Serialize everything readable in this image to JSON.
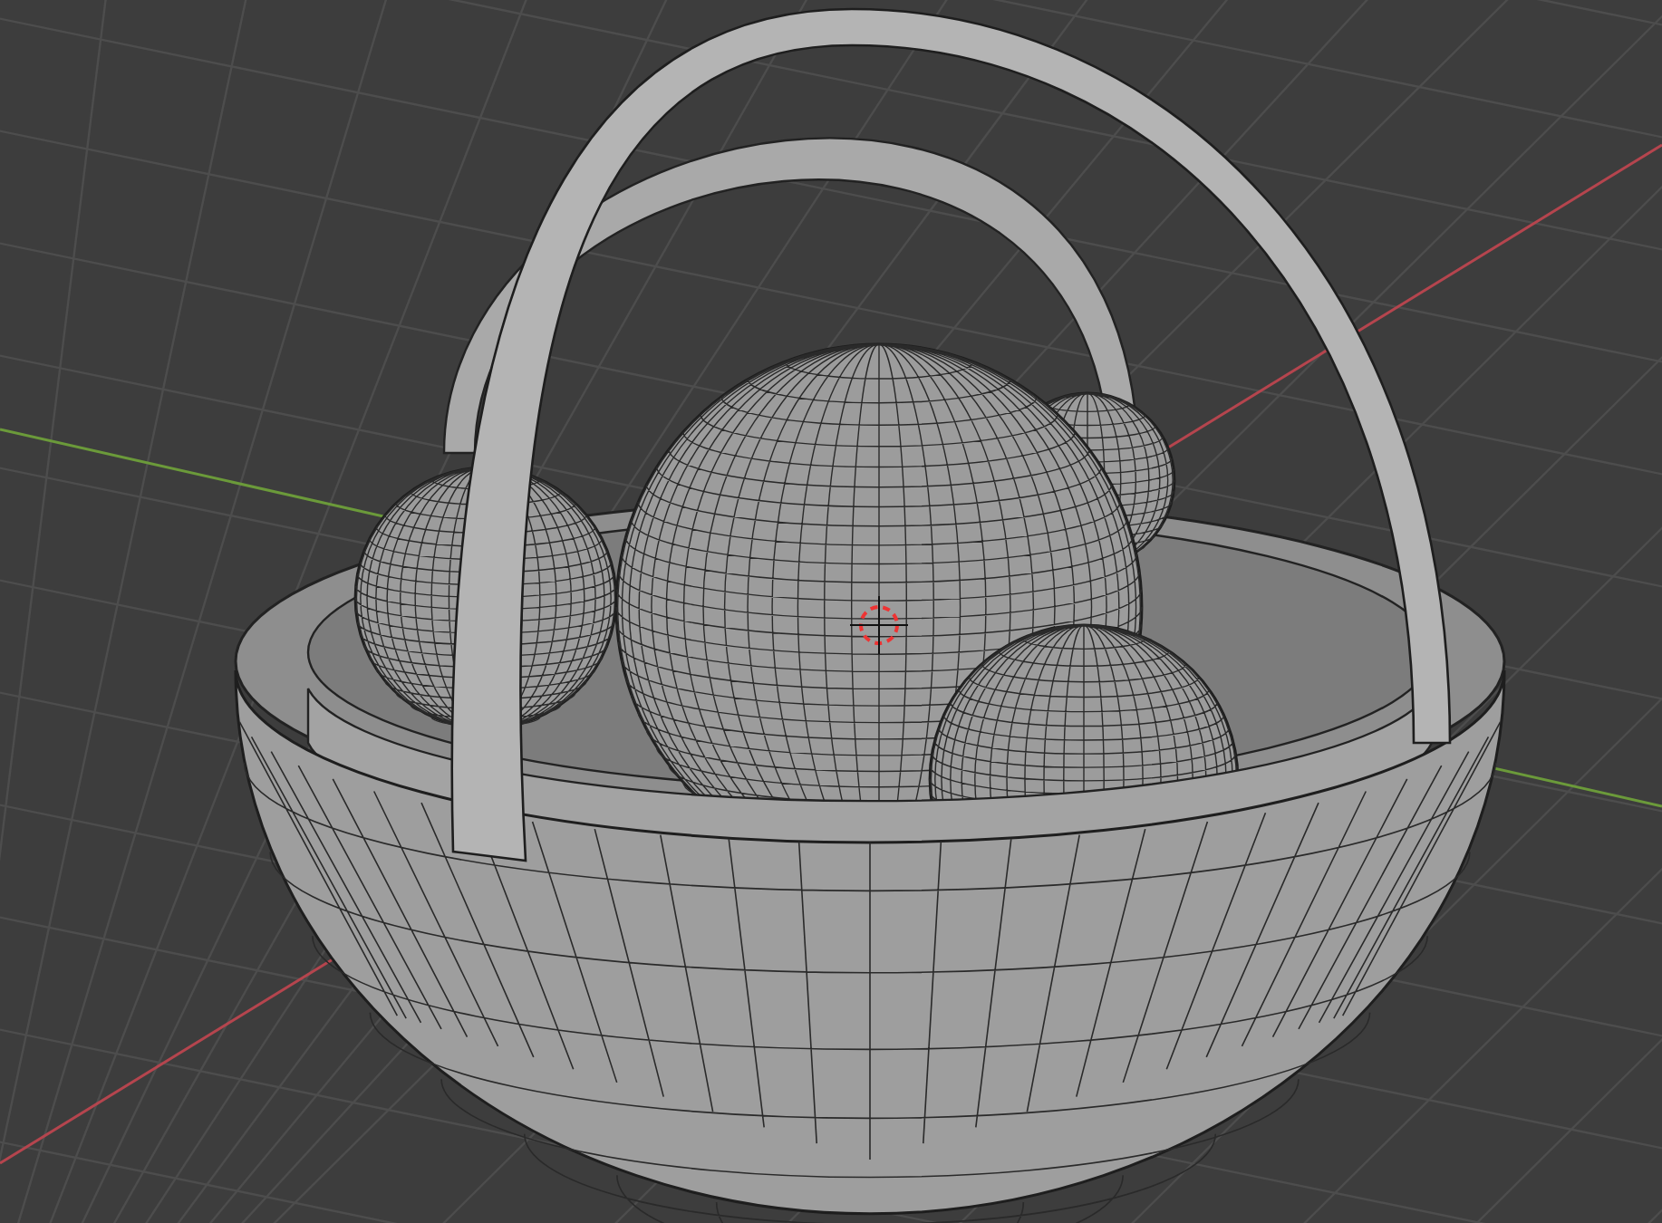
{
  "viewport": {
    "grid_visible": true,
    "axes_visible": true,
    "cursor_visible": true
  }
}
